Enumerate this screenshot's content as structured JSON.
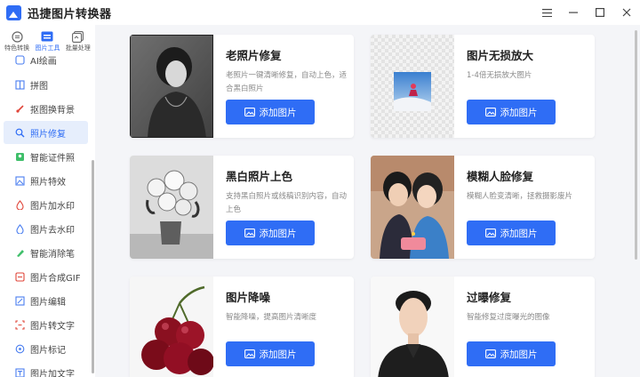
{
  "app": {
    "title": "迅捷图片转换器"
  },
  "rail": {
    "tabs": [
      {
        "label": "特色转换",
        "icon": "convert-icon"
      },
      {
        "label": "图片工具",
        "icon": "image-tools-icon"
      },
      {
        "label": "批量处理",
        "icon": "batch-icon"
      }
    ],
    "items": [
      {
        "label": "AI绘画",
        "icon": "ai-paint-icon"
      },
      {
        "label": "拼图",
        "icon": "collage-icon"
      },
      {
        "label": "抠图换背景",
        "icon": "cutout-icon"
      },
      {
        "label": "照片修复",
        "icon": "repair-icon"
      },
      {
        "label": "智能证件照",
        "icon": "id-photo-icon"
      },
      {
        "label": "照片特效",
        "icon": "effects-icon"
      },
      {
        "label": "图片加水印",
        "icon": "add-watermark-icon"
      },
      {
        "label": "图片去水印",
        "icon": "remove-watermark-icon"
      },
      {
        "label": "智能消除笔",
        "icon": "eraser-icon"
      },
      {
        "label": "图片合成GIF",
        "icon": "gif-icon"
      },
      {
        "label": "图片编辑",
        "icon": "edit-icon"
      },
      {
        "label": "图片转文字",
        "icon": "ocr-icon"
      },
      {
        "label": "图片标记",
        "icon": "mark-icon"
      },
      {
        "label": "图片加文字",
        "icon": "add-text-icon"
      }
    ],
    "active_item": "照片修复"
  },
  "cards": [
    {
      "title": "老照片修复",
      "desc": "老照片一键清晰修复，自动上色，适合黑白照片",
      "button": "添加图片"
    },
    {
      "title": "图片无损放大",
      "desc": "1-4倍无损放大图片",
      "button": "添加图片"
    },
    {
      "title": "黑白照片上色",
      "desc": "支持黑白照片或线稿识别内容，自动上色",
      "button": "添加图片"
    },
    {
      "title": "模糊人脸修复",
      "desc": "模糊人脸变清晰，拯救摄影废片",
      "button": "添加图片"
    },
    {
      "title": "图片降噪",
      "desc": "智能降噪，提高图片清晰度",
      "button": "添加图片"
    },
    {
      "title": "过曝修复",
      "desc": "智能修复过度曝光的图像",
      "button": "添加图片"
    }
  ],
  "colors": {
    "accent": "#2f6df5",
    "main_bg": "#f4f5f8",
    "active_bg": "#e6eefc"
  }
}
